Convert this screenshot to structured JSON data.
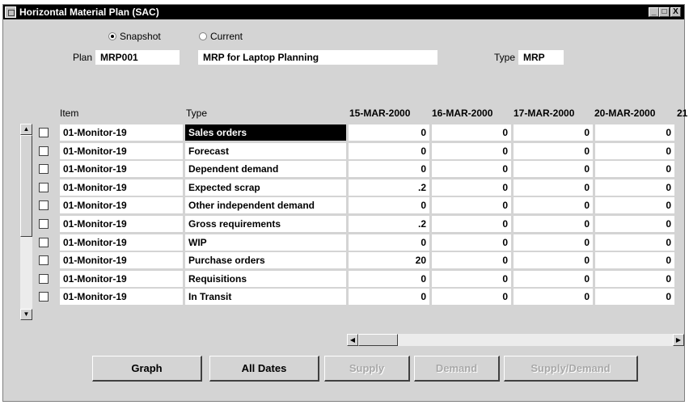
{
  "window": {
    "title": "Horizontal Material Plan (SAC)",
    "controls": {
      "minimize": "_",
      "maximize": "□",
      "close": "X"
    }
  },
  "view_mode": {
    "snapshot_label": "Snapshot",
    "current_label": "Current",
    "selected": "Snapshot"
  },
  "plan": {
    "plan_label": "Plan",
    "plan_value": "MRP001",
    "description": "MRP for Laptop Planning",
    "type_label": "Type",
    "type_value": "MRP"
  },
  "table": {
    "headers": {
      "item": "Item",
      "type": "Type",
      "dates": [
        "15-MAR-2000",
        "16-MAR-2000",
        "17-MAR-2000",
        "20-MAR-2000",
        "21"
      ]
    },
    "rows": [
      {
        "item": "01-Monitor-19",
        "type": "Sales orders",
        "values": [
          "0",
          "0",
          "0",
          "0"
        ],
        "selected": true
      },
      {
        "item": "01-Monitor-19",
        "type": "Forecast",
        "values": [
          "0",
          "0",
          "0",
          "0"
        ]
      },
      {
        "item": "01-Monitor-19",
        "type": "Dependent demand",
        "values": [
          "0",
          "0",
          "0",
          "0"
        ]
      },
      {
        "item": "01-Monitor-19",
        "type": "Expected scrap",
        "values": [
          ".2",
          "0",
          "0",
          "0"
        ]
      },
      {
        "item": "01-Monitor-19",
        "type": "Other independent demand",
        "values": [
          "0",
          "0",
          "0",
          "0"
        ]
      },
      {
        "item": "01-Monitor-19",
        "type": "Gross requirements",
        "values": [
          ".2",
          "0",
          "0",
          "0"
        ]
      },
      {
        "item": "01-Monitor-19",
        "type": "WIP",
        "values": [
          "0",
          "0",
          "0",
          "0"
        ]
      },
      {
        "item": "01-Monitor-19",
        "type": "Purchase orders",
        "values": [
          "20",
          "0",
          "0",
          "0"
        ]
      },
      {
        "item": "01-Monitor-19",
        "type": "Requisitions",
        "values": [
          "0",
          "0",
          "0",
          "0"
        ]
      },
      {
        "item": "01-Monitor-19",
        "type": "In Transit",
        "values": [
          "0",
          "0",
          "0",
          "0"
        ]
      }
    ]
  },
  "buttons": {
    "graph": "Graph",
    "all_dates": "All Dates",
    "supply": "Supply",
    "demand": "Demand",
    "supply_demand": "Supply/Demand"
  },
  "icons": {
    "window_icon": "app-window-icon",
    "scroll_up": "▲",
    "scroll_down": "▼",
    "scroll_left": "◀",
    "scroll_right": "▶"
  }
}
